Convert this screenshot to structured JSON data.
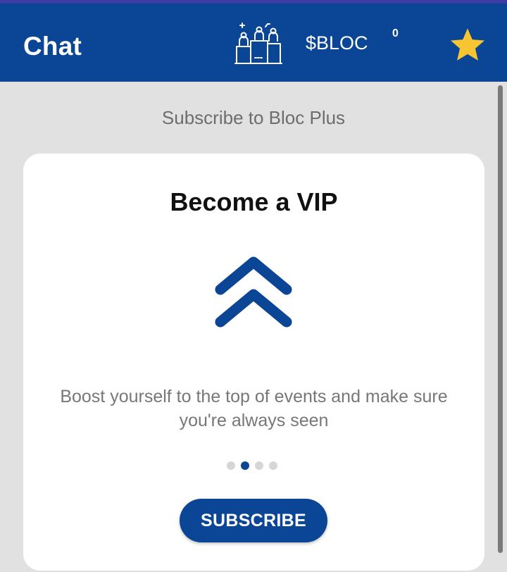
{
  "header": {
    "title": "Chat",
    "currency_label": "$BLOC",
    "balance": "0",
    "leaderboard_icon": "podium-icon",
    "favorite_icon": "star-icon",
    "colors": {
      "bar": "#0b4596",
      "star": "#f7c531"
    }
  },
  "content": {
    "subtitle": "Subscribe to Bloc Plus"
  },
  "card": {
    "title": "Become a VIP",
    "icon": "double-chevron-up-icon",
    "description": "Boost yourself to the top of events and make sure you're always seen",
    "carousel": {
      "total": 4,
      "active": 2
    },
    "button_label": "SUBSCRIBE"
  }
}
